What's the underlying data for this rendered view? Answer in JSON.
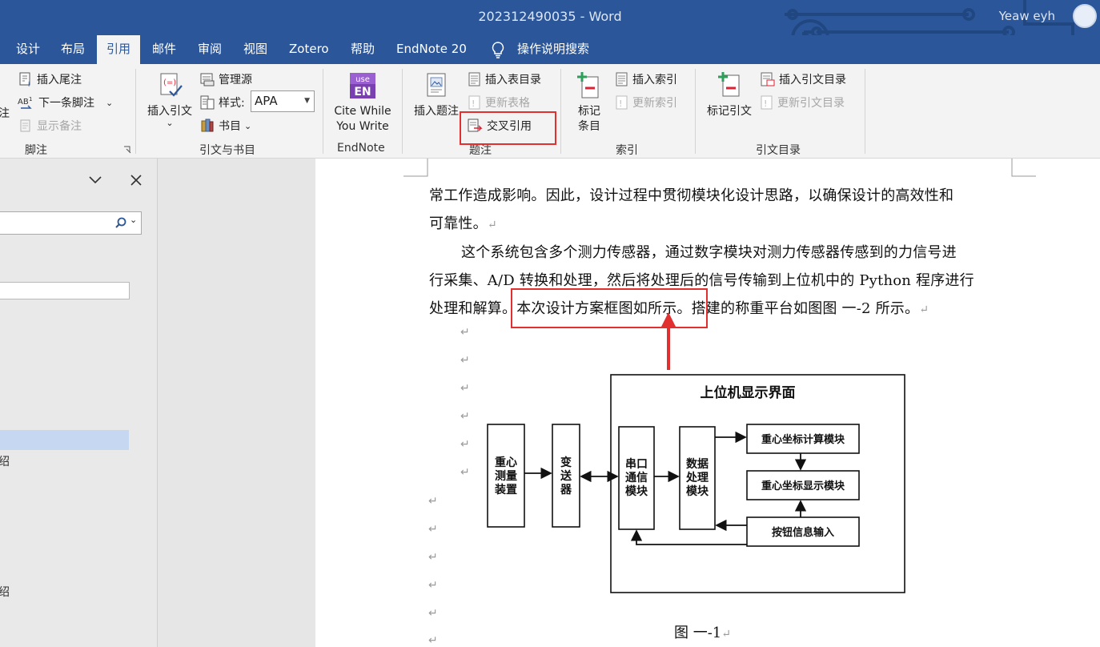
{
  "window": {
    "title": "202312490035 - Word",
    "user": "Yeaw eyh"
  },
  "tabs": [
    "设计",
    "布局",
    "引用",
    "邮件",
    "审阅",
    "视图",
    "Zotero",
    "帮助",
    "EndNote 20"
  ],
  "active_tab": "引用",
  "tell_me": "操作说明搜索",
  "ribbon": {
    "footnotes": {
      "insert_endnote": "插入尾注",
      "next_footnote": "下一条脚注",
      "show_notes": "显示备注",
      "partial_left": "注",
      "group": "脚注"
    },
    "citations": {
      "insert_citation": "插入引文",
      "manage_sources": "管理源",
      "style_label": "样式:",
      "style_value": "APA",
      "bibliography": "书目",
      "group": "引文与书目"
    },
    "endnote": {
      "cite_line1": "Cite While",
      "cite_line2": "You Write",
      "logo_top": "use",
      "logo_bottom": "EN",
      "group": "EndNote"
    },
    "captions": {
      "insert_caption": "插入题注",
      "insert_table_of_figures": "插入表目录",
      "update_table": "更新表格",
      "cross_reference": "交叉引用",
      "group": "题注"
    },
    "index": {
      "mark_entry_line1": "标记",
      "mark_entry_line2": "条目",
      "insert_index": "插入索引",
      "update_index": "更新索引",
      "group": "索引"
    },
    "toa": {
      "mark_citation": "标记引文",
      "insert_toa": "插入引文目录",
      "update_toa": "更新引文目录",
      "group": "引文目录"
    }
  },
  "nav_pane": {
    "item1_partial": "绍",
    "item2_partial": "绍"
  },
  "document": {
    "line1": "常工作造成影响。因此，设计过程中贯彻模块化设计思路，以确保设计的高效性和",
    "line2": "可靠性。",
    "line3": "这个系统包含多个测力传感器，通过数字模块对测力传感器传感到的力信号进",
    "line4": "行采集、A/D 转换和处理，然后将处理后的信号传输到上位机中的 Python 程序进行",
    "line5": "处理和解算。本次设计方案框图如所示。搭建的称重平台如图图  一-2 所示。",
    "paragraph_mark": "↵",
    "caption": "图  一-1"
  },
  "diagram": {
    "host_title": "上位机显示界面",
    "center_measure": [
      "重心",
      "测量",
      "装置"
    ],
    "transmitter": [
      "变",
      "送",
      "器"
    ],
    "serial": [
      "串口",
      "通信",
      "模块"
    ],
    "data_proc": [
      "数据",
      "处理",
      "模块"
    ],
    "calc": "重心坐标计算模块",
    "display": "重心坐标显示模块",
    "button": "按钮信息输入"
  }
}
